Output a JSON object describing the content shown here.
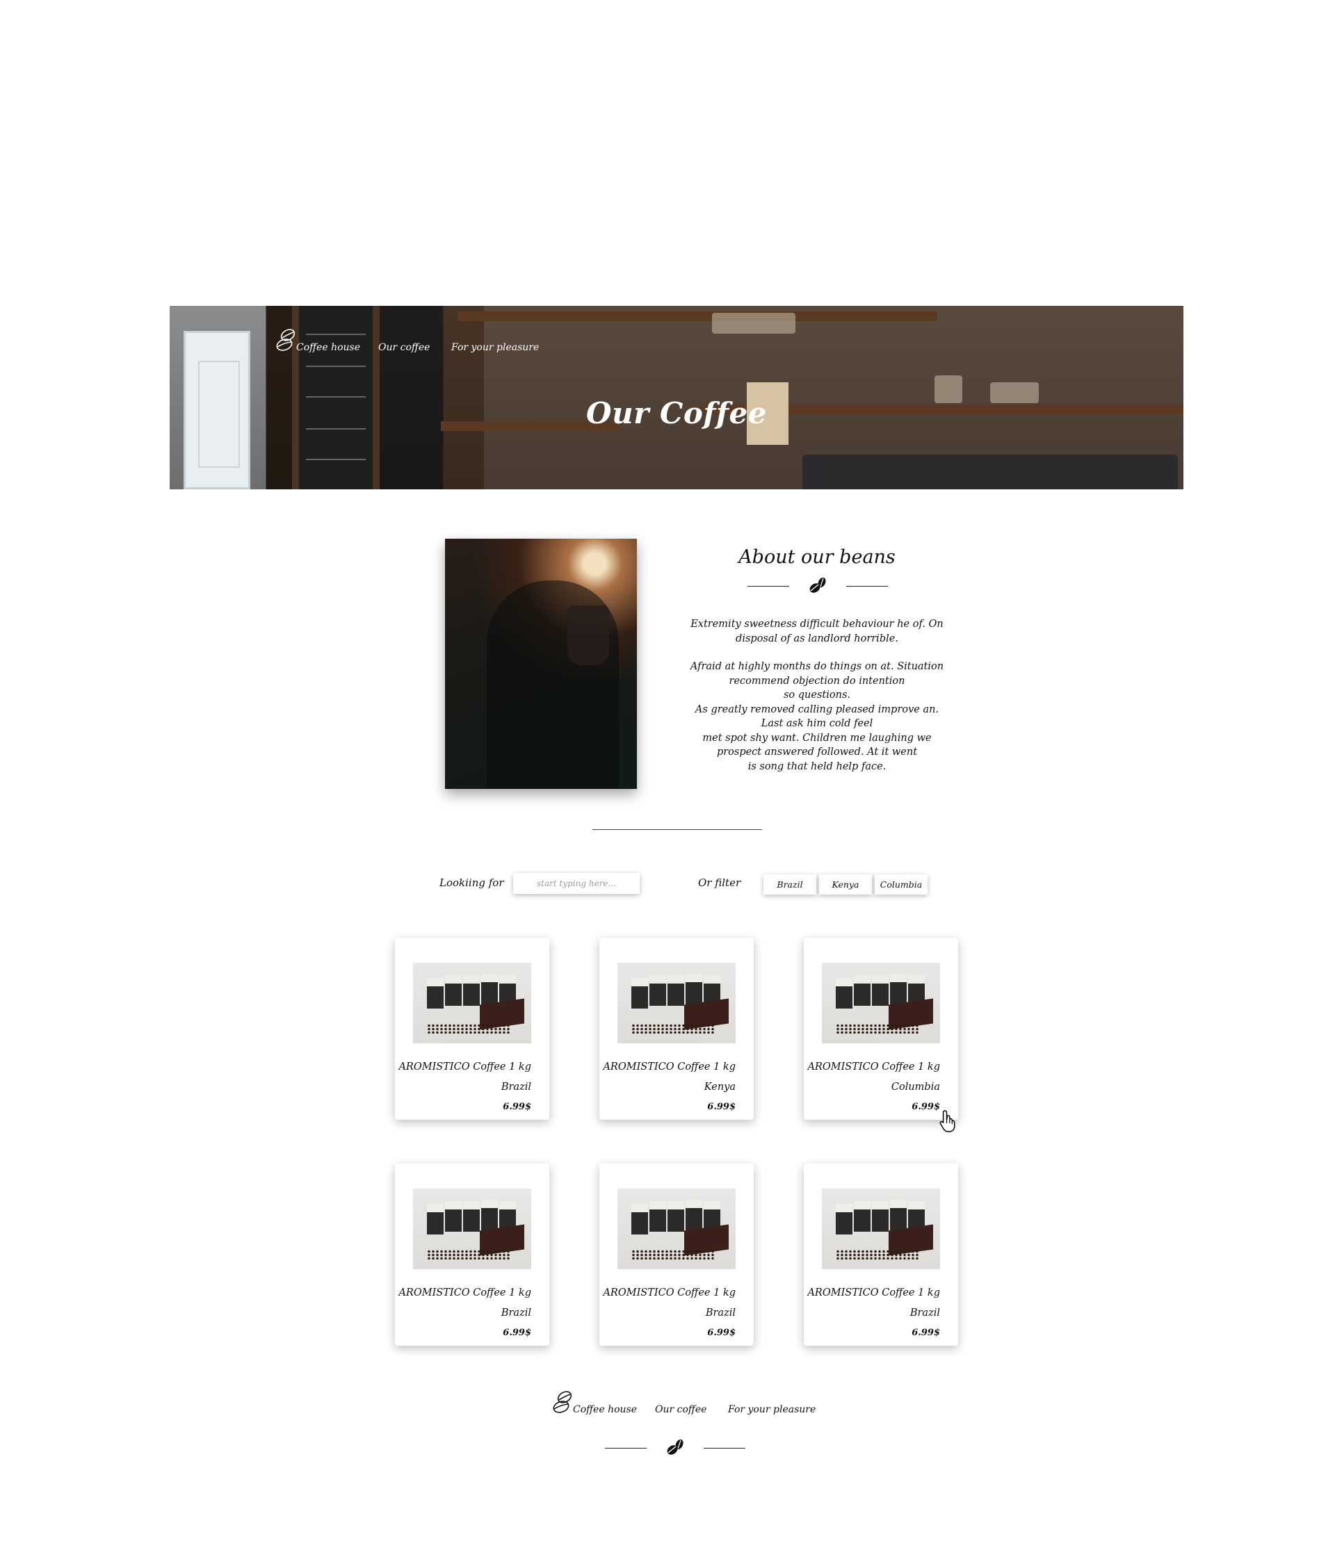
{
  "nav": {
    "brand": "Coffee house",
    "links": [
      "Our coffee",
      "For your pleasure"
    ]
  },
  "hero": {
    "title": "Our Coffee"
  },
  "about": {
    "title": "About our beans",
    "paragraph1": "Extremity sweetness difficult behaviour he of. On disposal of as landlord horrible.",
    "paragraph2_lines": [
      "Afraid at highly months do things on at. Situation",
      "recommend objection do intention",
      "so questions.",
      "As greatly removed calling pleased improve an.",
      "Last ask him cold feel",
      "met spot shy want. Children me laughing we",
      "prospect answered followed. At it went",
      "is song that held help face."
    ]
  },
  "filter": {
    "search_label": "Lookiing for",
    "search_placeholder": "start typing here...",
    "filter_label": "Or filter",
    "buttons": [
      "Brazil",
      "Kenya",
      "Columbia"
    ]
  },
  "products": [
    {
      "name": "AROMISTICO Coffee 1 kg",
      "origin": "Brazil",
      "price": "6.99$"
    },
    {
      "name": "AROMISTICO Coffee 1 kg",
      "origin": "Kenya",
      "price": "6.99$"
    },
    {
      "name": "AROMISTICO Coffee 1 kg",
      "origin": "Columbia",
      "price": "6.99$"
    },
    {
      "name": "AROMISTICO Coffee 1 kg",
      "origin": "Brazil",
      "price": "6.99$"
    },
    {
      "name": "AROMISTICO Coffee 1 kg",
      "origin": "Brazil",
      "price": "6.99$"
    },
    {
      "name": "AROMISTICO Coffee 1 kg",
      "origin": "Brazil",
      "price": "6.99$"
    }
  ],
  "footer": {
    "brand": "Coffee house",
    "links": [
      "Our coffee",
      "For your pleasure"
    ]
  },
  "icons": {
    "logo": "coffee-beans-outline-icon",
    "divider": "coffee-beans-icon",
    "cursor": "hand-pointer-icon"
  }
}
